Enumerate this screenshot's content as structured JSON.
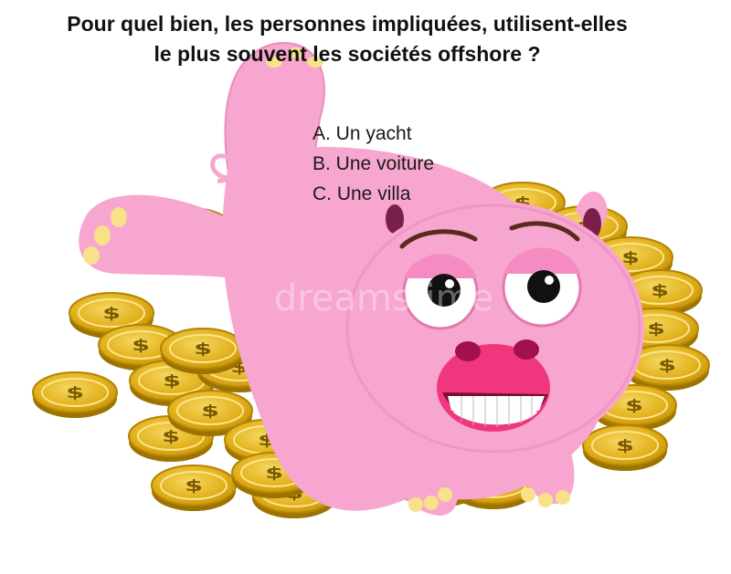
{
  "question": {
    "line1": "Pour quel bien, les personnes impliquées, utilisent-elles",
    "line2": "le plus souvent les sociétés offshore ?"
  },
  "options": [
    {
      "label": "A. Un yacht"
    },
    {
      "label": "B. Une voiture"
    },
    {
      "label": "C. Une villa"
    }
  ],
  "watermark": "dreamstime",
  "colors": {
    "pig": "#f7a6cf",
    "pig_dark": "#e98bbb",
    "snout": "#f0367c",
    "coin": "#e8b820",
    "coin_edge": "#b38400",
    "coin_dollar": "#7a5a00"
  }
}
